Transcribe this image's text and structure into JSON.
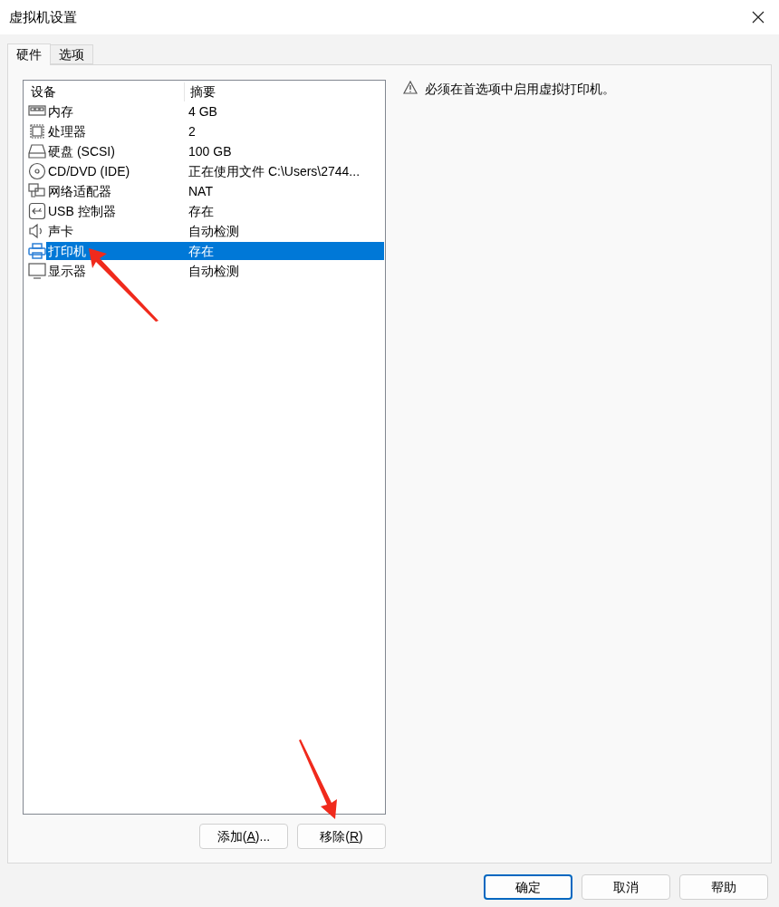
{
  "window": {
    "title": "虚拟机设置"
  },
  "tabs": [
    {
      "label": "硬件",
      "selected": true
    },
    {
      "label": "选项",
      "selected": false
    }
  ],
  "devices": {
    "columns": [
      "设备",
      "摘要"
    ],
    "rows": [
      {
        "kind": "memory",
        "name": "内存",
        "summary": "4 GB",
        "selected": false
      },
      {
        "kind": "cpu",
        "name": "处理器",
        "summary": "2",
        "selected": false
      },
      {
        "kind": "disk",
        "name": "硬盘 (SCSI)",
        "summary": "100 GB",
        "selected": false
      },
      {
        "kind": "cd",
        "name": "CD/DVD (IDE)",
        "summary": "正在使用文件 C:\\Users\\2744...",
        "selected": false
      },
      {
        "kind": "network",
        "name": "网络适配器",
        "summary": "NAT",
        "selected": false
      },
      {
        "kind": "usb",
        "name": "USB 控制器",
        "summary": "存在",
        "selected": false
      },
      {
        "kind": "sound",
        "name": "声卡",
        "summary": "自动检测",
        "selected": false
      },
      {
        "kind": "printer",
        "name": "打印机",
        "summary": "存在",
        "selected": true
      },
      {
        "kind": "display",
        "name": "显示器",
        "summary": "自动检测",
        "selected": false
      }
    ]
  },
  "list_buttons": [
    {
      "before": "添加(",
      "mnemonic": "A",
      "after": ")..."
    },
    {
      "before": "移除(",
      "mnemonic": "R",
      "after": ")"
    }
  ],
  "notice": "必须在首选项中启用虚拟打印机。",
  "dialog_buttons": [
    {
      "label": "确定",
      "default": true
    },
    {
      "label": "取消",
      "default": false
    },
    {
      "label": "帮助",
      "default": false
    }
  ]
}
